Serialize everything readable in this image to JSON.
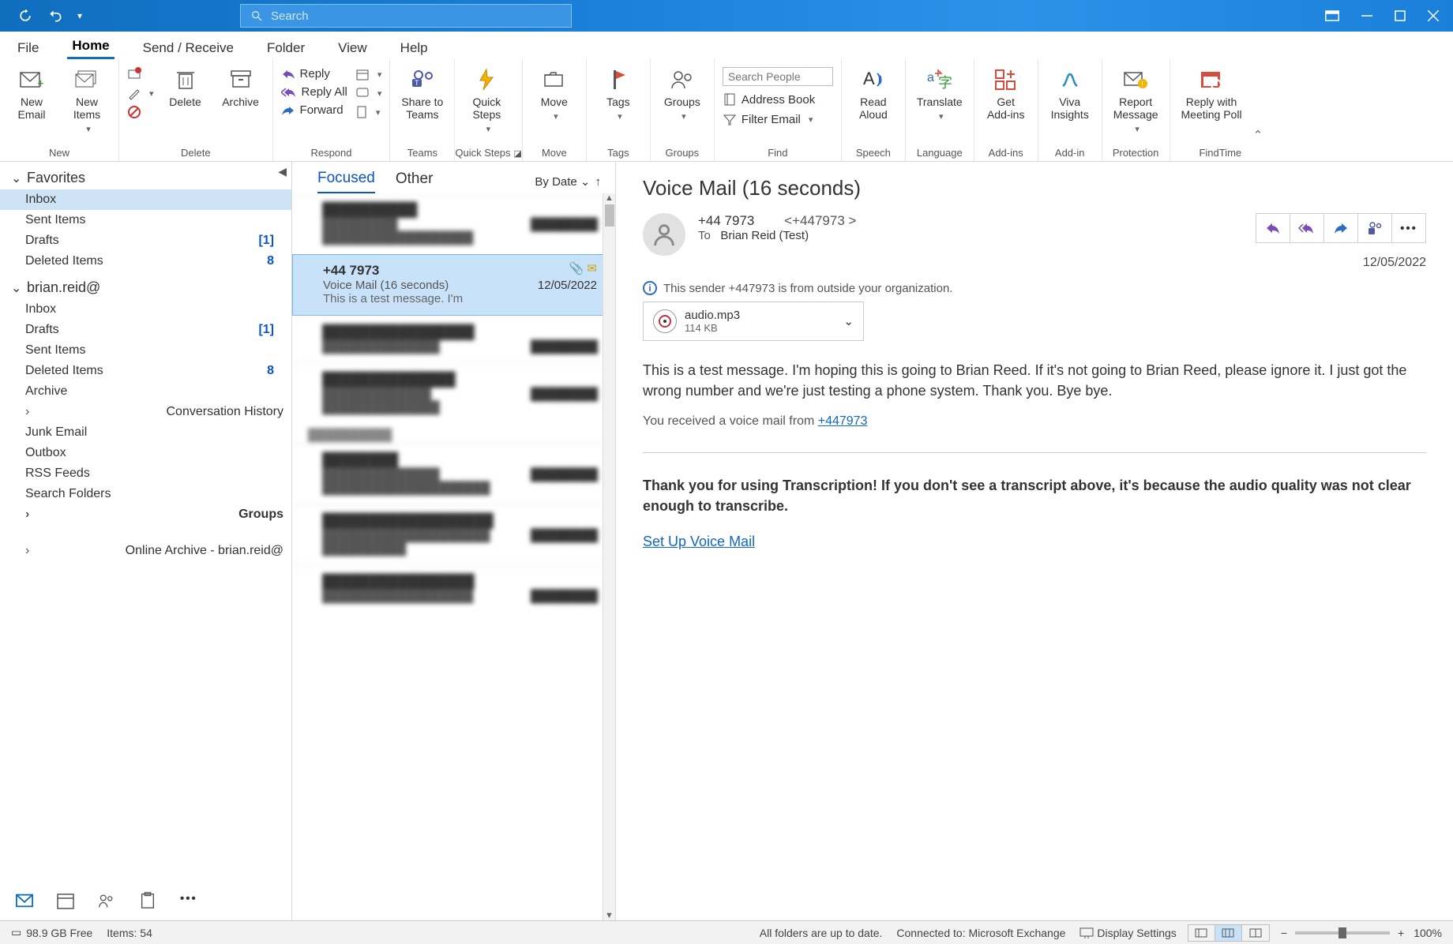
{
  "title_bar": {
    "search_placeholder": "Search"
  },
  "ribbon_tabs": [
    "File",
    "Home",
    "Send / Receive",
    "Folder",
    "View",
    "Help"
  ],
  "ribbon": {
    "new": {
      "label": "New",
      "new_email": "New\nEmail",
      "new_items": "New\nItems"
    },
    "delete": {
      "label": "Delete",
      "delete": "Delete",
      "archive": "Archive"
    },
    "respond": {
      "label": "Respond",
      "reply": "Reply",
      "reply_all": "Reply All",
      "forward": "Forward",
      "teams": "Share to\nTeams"
    },
    "teams_group": {
      "label": "Teams"
    },
    "quick_steps": {
      "label": "Quick Steps",
      "big": "Quick\nSteps"
    },
    "move": {
      "label": "Move",
      "big": "Move"
    },
    "tags": {
      "label": "Tags",
      "big": "Tags"
    },
    "groups": {
      "label": "Groups",
      "big": "Groups"
    },
    "find": {
      "label": "Find",
      "search_people_ph": "Search People",
      "address_book": "Address Book",
      "filter_email": "Filter Email"
    },
    "speech": {
      "label": "Speech",
      "big": "Read\nAloud"
    },
    "language": {
      "label": "Language",
      "big": "Translate"
    },
    "addins": {
      "label": "Add-ins",
      "big": "Get\nAdd-ins"
    },
    "addin": {
      "label": "Add-in",
      "big": "Viva\nInsights"
    },
    "protection": {
      "label": "Protection",
      "big": "Report\nMessage"
    },
    "findtime": {
      "label": "FindTime",
      "big": "Reply with\nMeeting Poll"
    }
  },
  "folders": {
    "favorites": "Favorites",
    "account": "brian.reid@",
    "inbox": "Inbox",
    "sent": "Sent Items",
    "drafts": "Drafts",
    "deleted": "Deleted Items",
    "drafts_count": "[1]",
    "deleted_count": "8",
    "archive": "Archive",
    "conv": "Conversation History",
    "junk": "Junk Email",
    "outbox": "Outbox",
    "rss": "RSS Feeds",
    "search": "Search Folders",
    "groups": "Groups",
    "online_archive": "Online Archive - brian.reid@"
  },
  "msglist": {
    "focused": "Focused",
    "other": "Other",
    "sort": "By Date",
    "active": {
      "from": "+44 7973",
      "subject": "Voice Mail (16 seconds)",
      "preview": "This is a test message. I'm",
      "date": "12/05/2022"
    }
  },
  "reading": {
    "subject": "Voice Mail (16 seconds)",
    "from_name": "+44 7973",
    "from_addr": "<+447973            >",
    "to_label": "To",
    "to": "Brian Reid (Test)",
    "date": "12/05/2022",
    "info": "This sender +447973            is from outside your organization.",
    "attach_name": "audio.mp3",
    "attach_size": "114 KB",
    "body1": "This is a test message. I'm hoping this is going to Brian Reed. If it's not going to Brian Reed, please ignore it. I just got the wrong number and we're just testing a phone system. Thank you. Bye bye.",
    "body2_pre": "You received a voice mail from ",
    "body2_link": "+447973",
    "body3": "Thank you for using Transcription! If you don't see a transcript above, it's because the audio quality was not clear enough to transcribe.",
    "body4": "Set Up Voice Mail"
  },
  "status": {
    "free": "98.9 GB Free",
    "items": "Items: 54",
    "sync": "All folders are up to date.",
    "connected": "Connected to: Microsoft Exchange",
    "display": "Display Settings",
    "zoom": "100%"
  }
}
